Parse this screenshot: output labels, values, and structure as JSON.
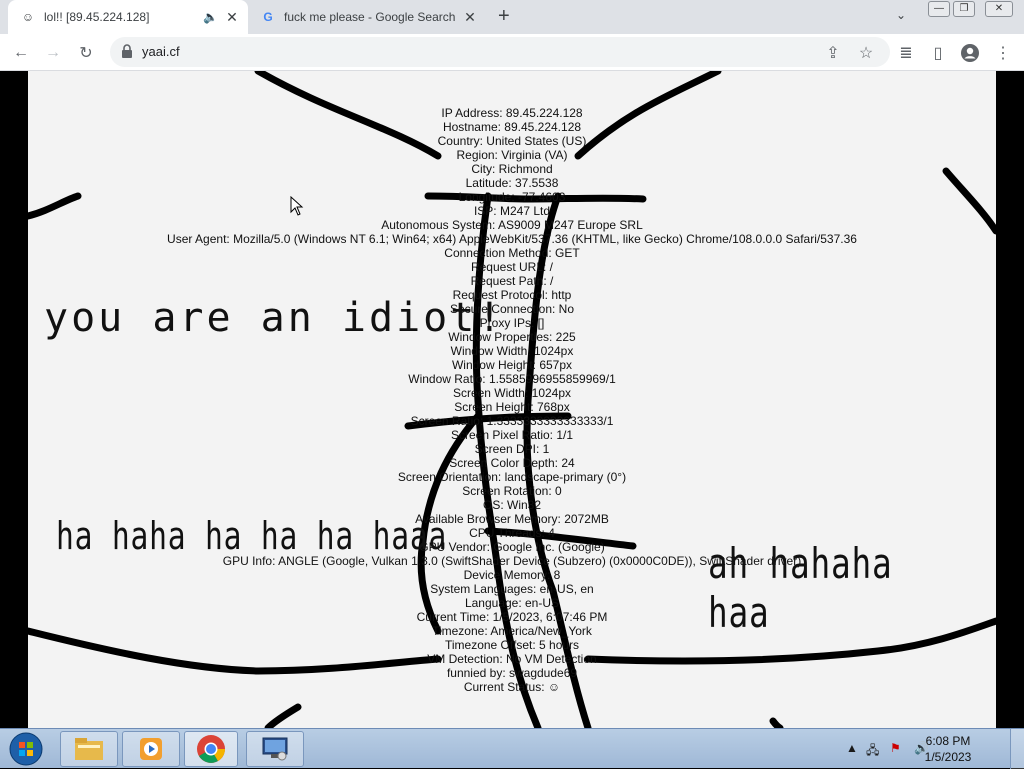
{
  "browser": {
    "tabs": [
      {
        "title": "lol!! [89.45.224.128]",
        "favicon": "smiley-icon",
        "audio": true,
        "active": true
      },
      {
        "title": "fuck me please - Google Search",
        "favicon": "google-icon",
        "audio": false,
        "active": false
      }
    ],
    "new_tab_label": "+",
    "url": "yaai.cf"
  },
  "page": {
    "info_lines": [
      "IP Address: 89.45.224.128",
      "Hostname: 89.45.224.128",
      "Country: United States (US)",
      "Region: Virginia (VA)",
      "City: Richmond",
      "Latitude: 37.5538",
      "Longitude: -77.4603",
      "ISP: M247 Ltd",
      "Autonomous System: AS9009 M247 Europe SRL",
      "User Agent: Mozilla/5.0 (Windows NT 6.1; Win64; x64) AppleWebKit/537.36 (KHTML, like Gecko) Chrome/108.0.0.0 Safari/537.36",
      "Connection Method: GET",
      "Request URL: /",
      "Request Path: /",
      "Request Protocol: http",
      "Secure Connection: No",
      "Proxy IPs: []",
      "Window Properties: 225",
      "Window Width: 1024px",
      "Window Height: 657px",
      "Window Ratio: 1.5585996955859969/1",
      "Screen Width: 1024px",
      "Screen Height: 768px",
      "Screen Ratio: 1.3333333333333333/1",
      "Screen Pixel Ratio: 1/1",
      "Screen DPI: 1",
      "Screen Color Depth: 24",
      "Screen Orientation: landscape-primary (0°)",
      "Screen Rotation: 0",
      "OS: Win32",
      "Available Browser Memory: 2072MB",
      "CPU Threads: 4",
      "GPU Vendor: Google Inc. (Google)",
      "GPU Info: ANGLE (Google, Vulkan 1.3.0 (SwiftShader Device (Subzero) (0x0000C0DE)), SwiftShader driver)",
      "Device Memory: 8",
      "System Languages: en-US, en",
      "Language: en-US",
      "Current Time: 1/5/2023, 6:07:46 PM",
      "Timezone: America/New_York",
      "Timezone Offset: 5 hours",
      "VM Detection: No VM Detection",
      "funnied by: swagdude69",
      "Current Status: ☺"
    ],
    "meme_text_1": "you are an idiot!",
    "meme_text_2": "ha haha ha ha ha haaa",
    "meme_text_3": "ah hahaha haa"
  },
  "taskbar": {
    "items": [
      "start-orb",
      "file-explorer",
      "media-player",
      "chrome",
      "network-app"
    ],
    "time": "6:08 PM",
    "date": "1/5/2023"
  }
}
